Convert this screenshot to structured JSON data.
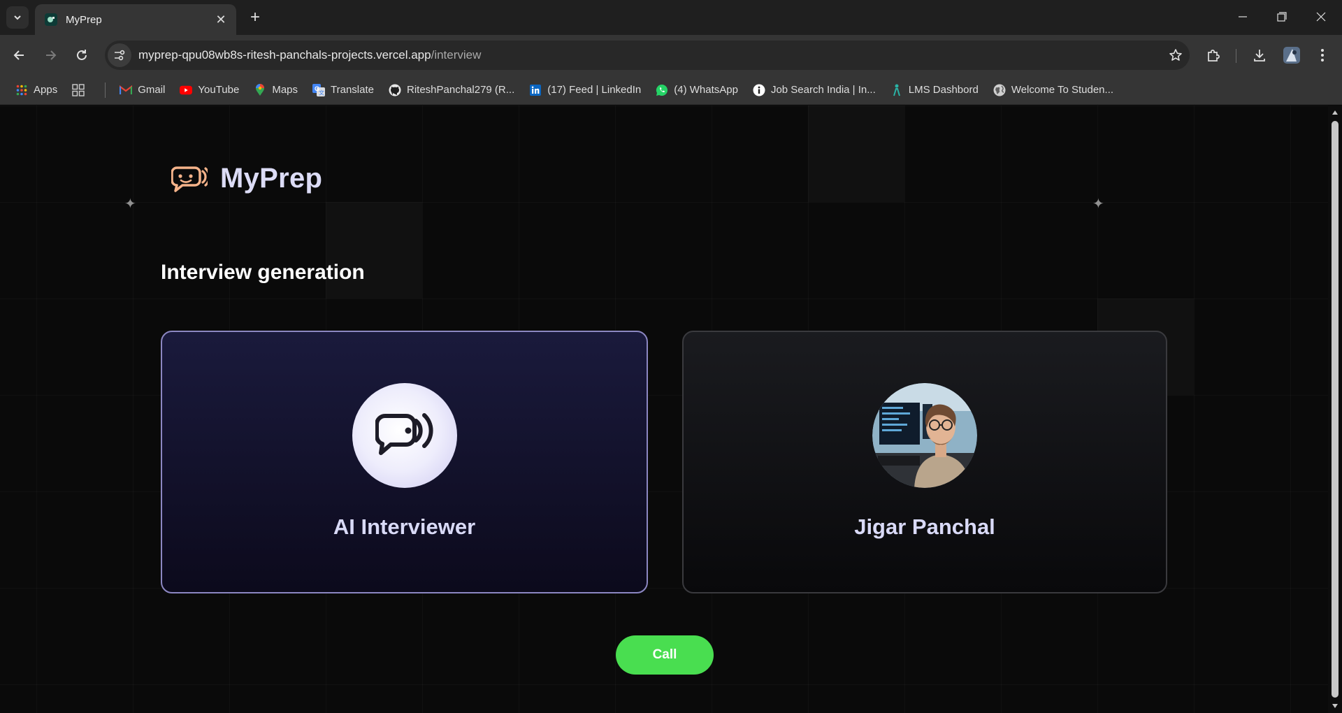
{
  "browser": {
    "tab_title": "MyPrep",
    "new_tab": "+",
    "url_host": "myprep-qpu08wb8s-ritesh-panchals-projects.vercel.app",
    "url_path": "/interview",
    "bookmarks": [
      {
        "label": "Apps",
        "icon": "apps-grid-icon"
      },
      {
        "label": "Gmail",
        "icon": "gmail-icon"
      },
      {
        "label": "YouTube",
        "icon": "youtube-icon"
      },
      {
        "label": "Maps",
        "icon": "maps-pin-icon"
      },
      {
        "label": "Translate",
        "icon": "translate-icon"
      },
      {
        "label": "RiteshPanchal279 (R...",
        "icon": "github-icon"
      },
      {
        "label": "(17) Feed | LinkedIn",
        "icon": "linkedin-icon"
      },
      {
        "label": "(4) WhatsApp",
        "icon": "whatsapp-icon"
      },
      {
        "label": "Job Search India | In...",
        "icon": "info-icon"
      },
      {
        "label": "LMS Dashbord",
        "icon": "lms-icon"
      },
      {
        "label": "Welcome To Studen...",
        "icon": "globe-icon"
      }
    ]
  },
  "app": {
    "brand": "MyPrep",
    "section_title": "Interview generation",
    "interviewer_name": "AI Interviewer",
    "user_name": "Jigar Panchal",
    "call_label": "Call"
  },
  "colors": {
    "accent_green": "#49de50",
    "brand_text": "#dcdcf6",
    "logo_orange": "#f5b38a",
    "ai_card_border": "#8c87c2"
  }
}
